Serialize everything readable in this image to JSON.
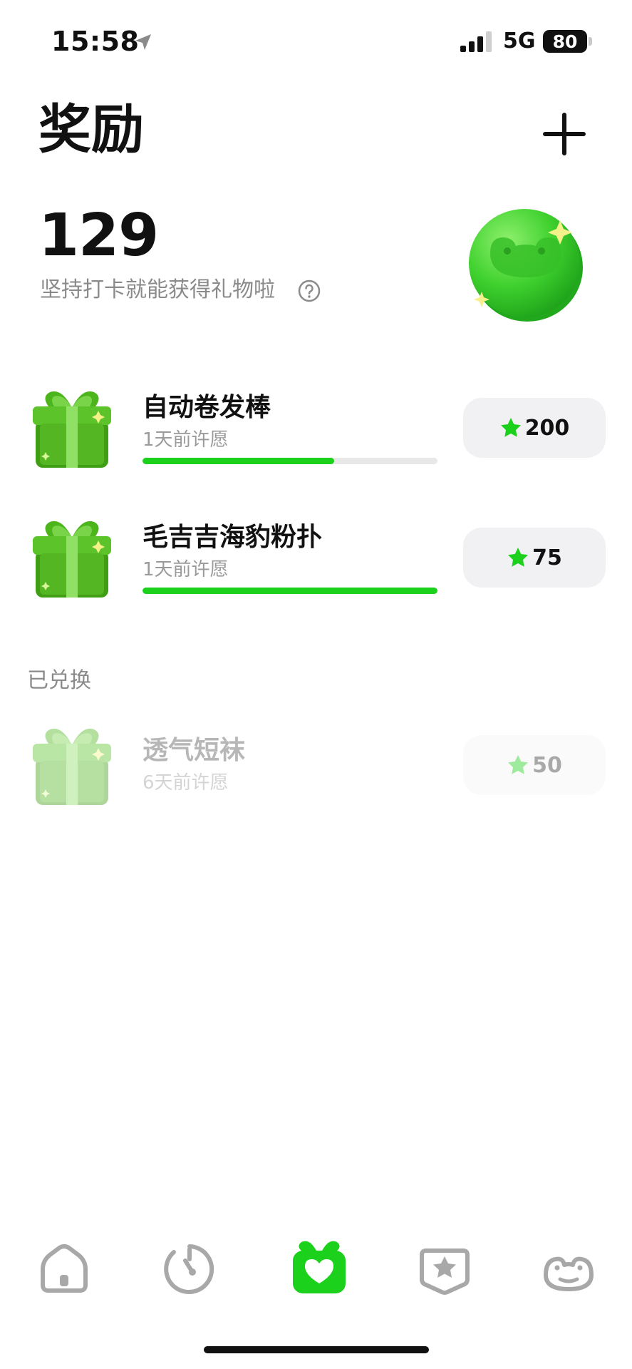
{
  "status_bar": {
    "time": "15:58",
    "network": "5G",
    "battery": "80"
  },
  "header": {
    "title": "奖励",
    "add_icon": "plus-icon"
  },
  "summary": {
    "points": "129",
    "subtitle": "坚持打卡就能获得礼物啦",
    "help_icon": "question-circle-icon",
    "coin_icon": "frog-coin-icon"
  },
  "rewards": [
    {
      "name": "自动卷发棒",
      "time": "1天前许愿",
      "cost": "200",
      "progress": 0.65
    },
    {
      "name": "毛吉吉海豹粉扑",
      "time": "1天前许愿",
      "cost": "75",
      "progress": 1.0
    }
  ],
  "redeemed_section": {
    "label": "已兑换",
    "items": [
      {
        "name": "透气短袜",
        "time": "6天前许愿",
        "cost": "50"
      }
    ]
  },
  "tabs": [
    {
      "icon": "home-icon",
      "active": false
    },
    {
      "icon": "timer-icon",
      "active": false
    },
    {
      "icon": "gift-heart-icon",
      "active": true
    },
    {
      "icon": "star-badge-icon",
      "active": false
    },
    {
      "icon": "frog-icon",
      "active": false
    }
  ],
  "colors": {
    "accent": "#1bd11b",
    "gift_green": "#4db51c",
    "inactive_tab": "#a8a8a8",
    "text_secondary": "#8a8a8a"
  }
}
